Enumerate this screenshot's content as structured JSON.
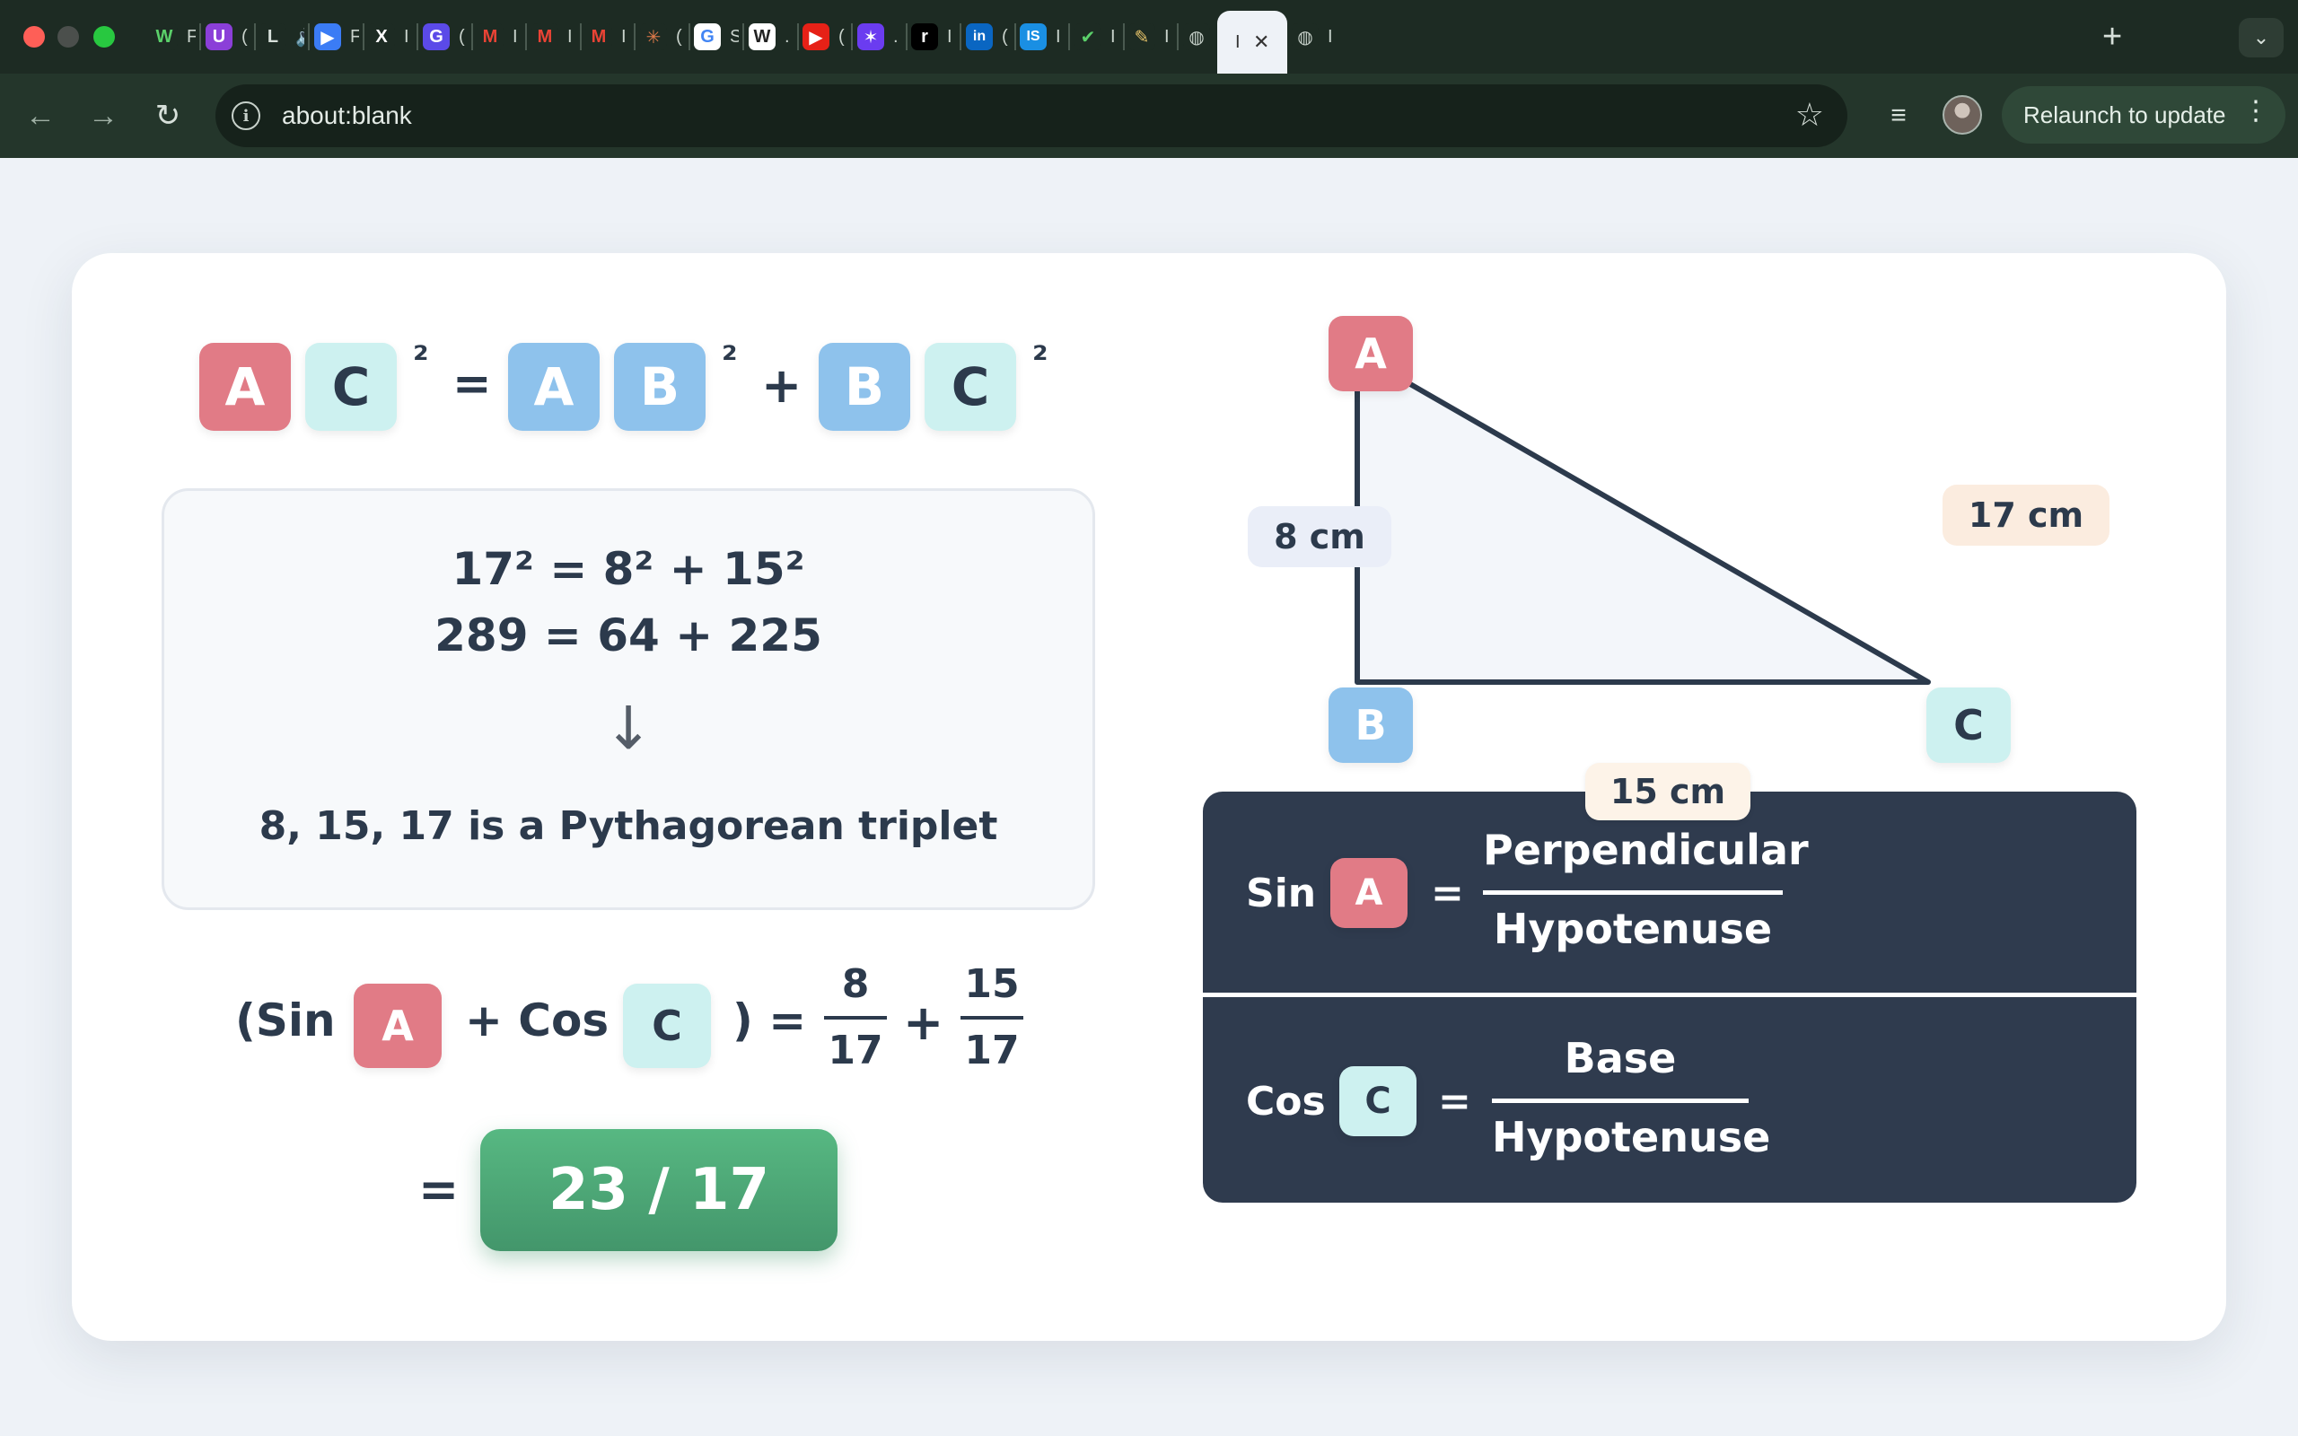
{
  "browser": {
    "tabs": [
      {
        "icon": "w-icon",
        "glyph": "W",
        "color": "#1d2b23",
        "fg": "#5bd06a",
        "title": "F"
      },
      {
        "icon": "u-icon",
        "glyph": "U",
        "color": "#8b3fd8",
        "fg": "#fff",
        "title": "("
      },
      {
        "icon": "l-icon",
        "glyph": "L",
        "color": "#1d2b23",
        "fg": "#d7e0da",
        "title": "🔊"
      },
      {
        "icon": "play-icon",
        "glyph": "▶",
        "color": "#3b7cf5",
        "fg": "#fff",
        "title": "F"
      },
      {
        "icon": "x-icon",
        "glyph": "X",
        "color": "#1d2b23",
        "fg": "#fff",
        "title": "I"
      },
      {
        "icon": "g-icon",
        "glyph": "G",
        "color": "#5b4ae8",
        "fg": "#fff",
        "title": "("
      },
      {
        "icon": "gmail-icon",
        "glyph": "M",
        "color": "#1d2b23",
        "fg": "#ea4335",
        "title": "I"
      },
      {
        "icon": "gmail-icon",
        "glyph": "M",
        "color": "#1d2b23",
        "fg": "#ea4335",
        "title": "I"
      },
      {
        "icon": "gmail-icon",
        "glyph": "M",
        "color": "#1d2b23",
        "fg": "#ea4335",
        "title": "I"
      },
      {
        "icon": "sparkle-icon",
        "glyph": "✳",
        "color": "#1d2b23",
        "fg": "#e07a4a",
        "title": "("
      },
      {
        "icon": "google-icon",
        "glyph": "G",
        "color": "#ffffff",
        "fg": "#4285f4",
        "title": "S"
      },
      {
        "icon": "w-doc-icon",
        "glyph": "W",
        "color": "#ffffff",
        "fg": "#222",
        "title": "."
      },
      {
        "icon": "youtube-icon",
        "glyph": "▶",
        "color": "#e62117",
        "fg": "#fff",
        "title": "("
      },
      {
        "icon": "star-app-icon",
        "glyph": "✶",
        "color": "#6b3cf0",
        "fg": "#fff",
        "title": "."
      },
      {
        "icon": "r-icon",
        "glyph": "r",
        "color": "#000000",
        "fg": "#fff",
        "title": "I"
      },
      {
        "icon": "linkedin-icon",
        "glyph": "in",
        "color": "#0a66c2",
        "fg": "#fff",
        "title": "("
      },
      {
        "icon": "is-icon",
        "glyph": "IS",
        "color": "#1a8fe3",
        "fg": "#fff",
        "title": "I"
      },
      {
        "icon": "check-icon",
        "glyph": "✔",
        "color": "#1d2b23",
        "fg": "#5bd06a",
        "title": "I"
      },
      {
        "icon": "pen-icon",
        "glyph": "✎",
        "color": "#1d2b23",
        "fg": "#e8c46a",
        "title": "I"
      },
      {
        "icon": "globe-icon",
        "glyph": "◍",
        "color": "#1d2b23",
        "fg": "#c7d1ca",
        "title": "I"
      },
      {
        "icon": "active-tab",
        "glyph": "",
        "color": "#eef2f7",
        "fg": "#333",
        "title": "I"
      },
      {
        "icon": "globe-icon",
        "glyph": "◍",
        "color": "#1d2b23",
        "fg": "#c7d1ca",
        "title": "I"
      }
    ],
    "url": "about:blank",
    "relaunch_label": "Relaunch to update",
    "new_tab_glyph": "+",
    "tab_menu_glyph": "⌄",
    "close_glyph": "✕"
  },
  "page": {
    "pythagoras": {
      "tiles": [
        {
          "letter": "A",
          "color": "red"
        },
        {
          "letter": "C",
          "color": "cyan"
        },
        {
          "letter": "A",
          "color": "blue"
        },
        {
          "letter": "B",
          "color": "blue"
        },
        {
          "letter": "B",
          "color": "blue"
        },
        {
          "letter": "C",
          "color": "cyan"
        }
      ],
      "square": "²",
      "equals": "=",
      "plus": "+"
    },
    "proof": {
      "line1": "17² = 8² + 15²",
      "line2": "289 = 64 + 225",
      "arrow": "↓",
      "conclusion": "8, 15, 17 is a Pythagorean triplet"
    },
    "sum_expr": {
      "open": "(Sin",
      "tile_a": "A",
      "plus_cos": "+ Cos",
      "tile_c": "C",
      "close": ") =",
      "frac1_num": "8",
      "frac1_den": "17",
      "plus": "+",
      "frac2_num": "15",
      "frac2_den": "17",
      "equals": "=",
      "result": "23 / 17"
    },
    "triangle": {
      "vertex_a": "A",
      "vertex_b": "B",
      "vertex_c": "C",
      "side_ab": "8 cm",
      "side_ac": "17 cm",
      "side_bc": "15 cm"
    },
    "ratios": {
      "sin_word": "Sin",
      "sin_tile": "A",
      "sin_eq": "=",
      "sin_num": "Perpendicular",
      "sin_den": "Hypotenuse",
      "cos_word": "Cos",
      "cos_tile": "C",
      "cos_eq": "=",
      "cos_num": "Base",
      "cos_den": "Hypotenuse"
    },
    "colors": {
      "tile_red": "#e17b86",
      "tile_blue": "#8ec2ec",
      "tile_cyan": "#cdf1f0",
      "result_green": "#4aa675",
      "panel_dark": "#2f3b4e"
    }
  }
}
